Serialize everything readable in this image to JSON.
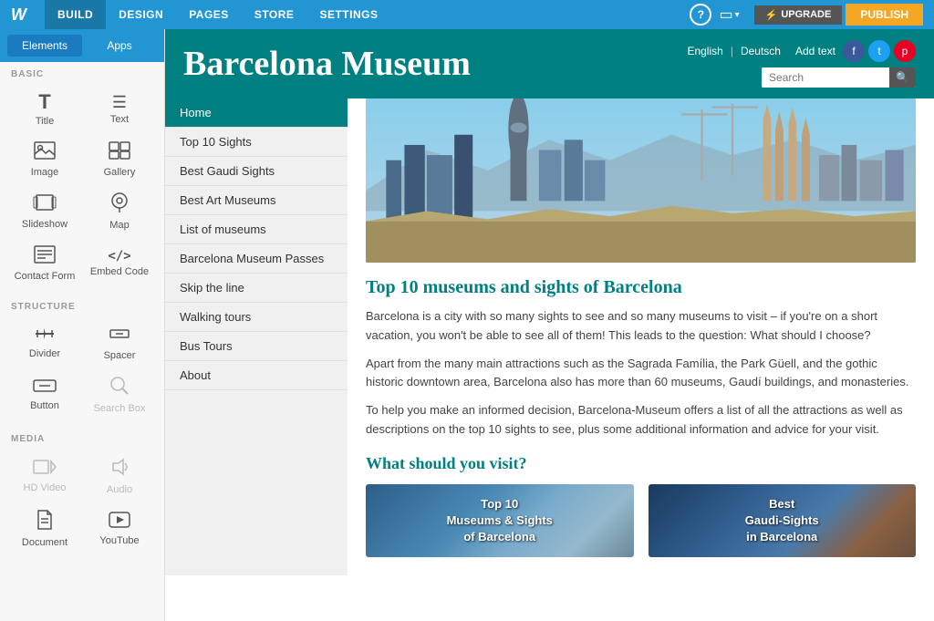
{
  "topNav": {
    "logo": "W",
    "items": [
      "BUILD",
      "DESIGN",
      "PAGES",
      "STORE",
      "SETTINGS"
    ],
    "activeItem": "BUILD",
    "upgradeLabel": "UPGRADE",
    "publishLabel": "PUBLISH"
  },
  "sidebar": {
    "tabs": [
      {
        "label": "Elements",
        "active": true
      },
      {
        "label": "Apps",
        "active": false
      }
    ],
    "sections": {
      "basic": {
        "label": "BASIC",
        "items": [
          {
            "icon": "T",
            "label": "Title",
            "disabled": false
          },
          {
            "icon": "≡",
            "label": "Text",
            "disabled": false
          },
          {
            "icon": "🖼",
            "label": "Image",
            "disabled": false
          },
          {
            "icon": "⊞",
            "label": "Gallery",
            "disabled": false
          },
          {
            "icon": "▶",
            "label": "Slideshow",
            "disabled": false
          },
          {
            "icon": "◎",
            "label": "Map",
            "disabled": false
          },
          {
            "icon": "⊟",
            "label": "Contact Form",
            "disabled": false
          },
          {
            "icon": "</>",
            "label": "Embed Code",
            "disabled": false
          }
        ]
      },
      "structure": {
        "label": "STRUCTURE",
        "items": [
          {
            "icon": "⊕",
            "label": "Divider",
            "disabled": false
          },
          {
            "icon": "⊡",
            "label": "Spacer",
            "disabled": false
          },
          {
            "icon": "▬",
            "label": "Button",
            "disabled": false
          },
          {
            "icon": "🔍",
            "label": "Search Box",
            "disabled": true
          }
        ]
      },
      "media": {
        "label": "MEDIA",
        "items": [
          {
            "icon": "▶",
            "label": "HD Video",
            "disabled": true
          },
          {
            "icon": "♪",
            "label": "Audio",
            "disabled": true
          },
          {
            "icon": "📄",
            "label": "Document",
            "disabled": false
          },
          {
            "icon": "▶",
            "label": "YouTube",
            "disabled": false
          }
        ]
      }
    }
  },
  "site": {
    "title": "Barcelona Museum",
    "headerBg": "#008080",
    "langLinks": [
      "English",
      "Deutsch"
    ],
    "addText": "Add text",
    "searchPlaceholder": "Search",
    "nav": {
      "items": [
        {
          "label": "Home",
          "active": true
        },
        {
          "label": "Top 10 Sights",
          "active": false
        },
        {
          "label": "Best Gaudi Sights",
          "active": false
        },
        {
          "label": "Best Art Museums",
          "active": false
        },
        {
          "label": "List of museums",
          "active": false
        },
        {
          "label": "Barcelona Museum Passes",
          "active": false
        },
        {
          "label": "Skip the line",
          "active": false
        },
        {
          "label": "Walking tours",
          "active": false
        },
        {
          "label": "Bus Tours",
          "active": false
        },
        {
          "label": "About",
          "active": false
        }
      ]
    },
    "content": {
      "mainHeading": "Top 10 museums and sights of Barcelona",
      "para1": "Barcelona is a city with so many sights to see and so many museums to visit – if you're on a short vacation, you won't be able to see all of them! This leads to the question: What should I choose?",
      "para2": "Apart from the many main attractions such as the Sagrada Família, the Park Güell, and the gothic historic downtown area, Barcelona also has more than 60 museums, Gaudí buildings, and monasteries.",
      "para3": "To help you make an informed decision, Barcelona-Museum offers a list of all the attractions as well as descriptions on the top 10 sights to see, plus some additional information and advice for your visit.",
      "subHeading": "What should you visit?",
      "card1Text": "Top 10\nMuseums & Sights\nof Barcelona",
      "card2Text": "Best\nGaudi-Sights\nin Barcelona"
    }
  }
}
